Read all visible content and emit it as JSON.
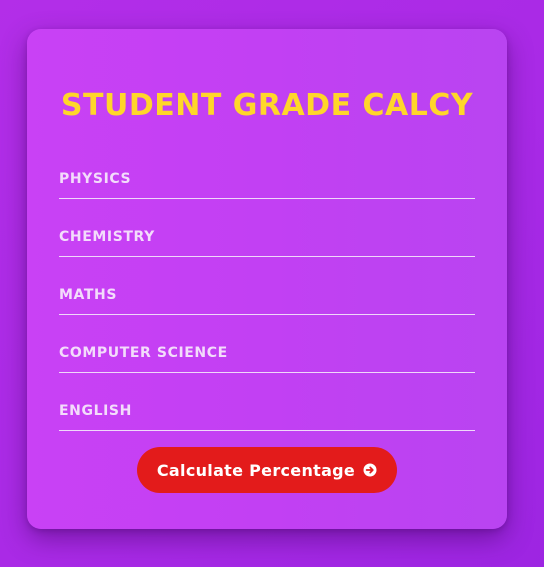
{
  "card": {
    "title": "STUDENT GRADE CALCY"
  },
  "fields": [
    {
      "label": "PHYSICS",
      "value": ""
    },
    {
      "label": "CHEMISTRY",
      "value": ""
    },
    {
      "label": "MATHS",
      "value": ""
    },
    {
      "label": "COMPUTER SCIENCE",
      "value": ""
    },
    {
      "label": "ENGLISH",
      "value": ""
    }
  ],
  "button": {
    "label": "Calculate Percentage",
    "icon": "arrow-circle-right-icon"
  },
  "colors": {
    "background": "#b32ee8",
    "card": "#c441f4",
    "title": "#ffd62a",
    "label": "#f3dcfb",
    "button": "#e31b1b",
    "button_text": "#ffffff"
  }
}
